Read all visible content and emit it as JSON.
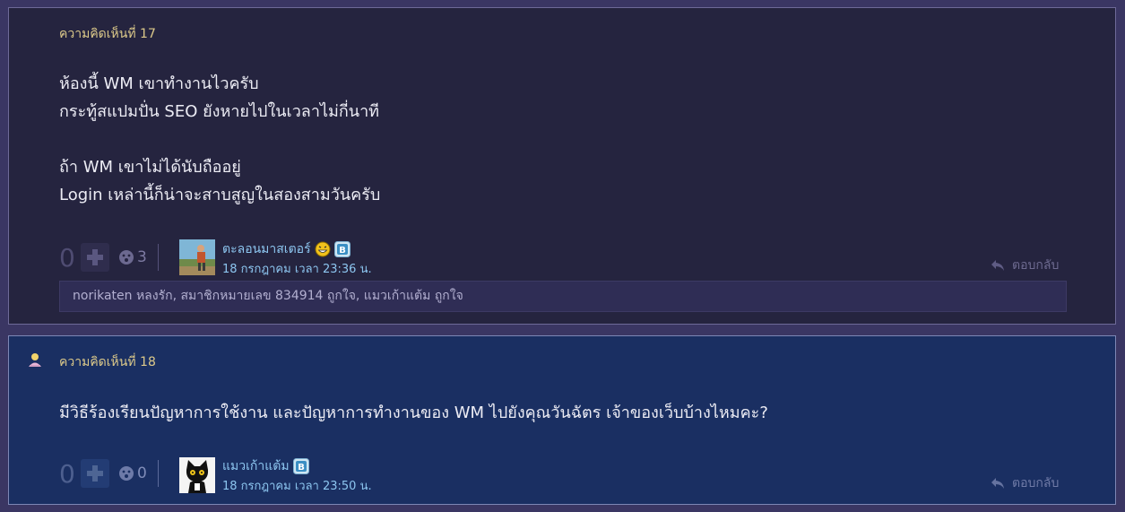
{
  "comments": [
    {
      "number_label": "ความคิดเห็นที่ 17",
      "lines": [
        "ห้องนี้ WM เขาทำงานไวครับ",
        "กระทู้สแปมปั่น SEO ยังหายไปในเวลาไม่กี่นาที",
        "ถ้า WM เขาไม่ได้นับถืออยู่",
        "Login เหล่านี้ก็น่าจะสาบสูญในสองสามวันครับ"
      ],
      "vote_count": "0",
      "emotion_count": "3",
      "author": "ตะลอนมาสเตอร์",
      "timestamp": "18 กรกฎาคม เวลา 23:36 น.",
      "reply_label": "ตอบกลับ",
      "likers": "norikaten หลงรัก, สมาชิกหมายเลข 834914 ถูกใจ, แมวเก้าแต้ม ถูกใจ"
    },
    {
      "number_label": "ความคิดเห็นที่ 18",
      "lines": [
        "มีวิธีร้องเรียนปัญหาการใช้งาน และปัญหาการทำงานของ WM ไปยังคุณวันฉัตร เจ้าของเว็บบ้างไหมคะ?"
      ],
      "vote_count": "0",
      "emotion_count": "0",
      "author": "แมวเก้าแต้ม",
      "timestamp": "18 กรกฎาคม เวลา 23:50 น.",
      "reply_label": "ตอบกลับ"
    }
  ],
  "icons": {
    "plus": "plus-icon",
    "emotion": "emotion-face-icon",
    "reply": "reply-arrow-icon",
    "badge": "bloggang-b-icon",
    "grin": "grin-emoji-icon",
    "owner": "topic-owner-icon"
  },
  "colors": {
    "page_bg": "#3a3663",
    "comment17_bg": "#25243f",
    "comment18_bg": "#1a2f62",
    "number_label": "#dcc98a",
    "author_link": "#8dc6f0"
  }
}
